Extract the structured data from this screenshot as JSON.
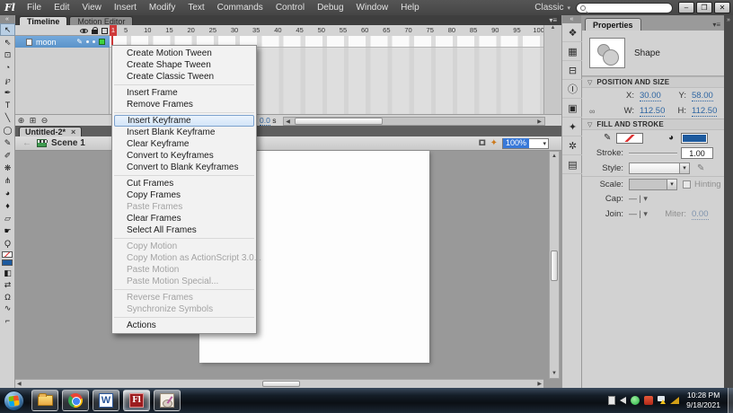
{
  "titlebar": {
    "logo": "Fl",
    "menus": [
      "File",
      "Edit",
      "View",
      "Insert",
      "Modify",
      "Text",
      "Commands",
      "Control",
      "Debug",
      "Window",
      "Help"
    ],
    "workspace": "Classic",
    "window": {
      "minimize": "–",
      "restore": "❐",
      "close": "✕"
    }
  },
  "tools": {
    "collapse": "«",
    "main": [
      {
        "name": "selection-tool",
        "glyph": "↖",
        "active": true
      },
      {
        "name": "subselection-tool",
        "glyph": "⇖"
      },
      {
        "name": "free-transform-tool",
        "glyph": "⊡"
      },
      {
        "name": "3d-rotation-tool",
        "glyph": "◔"
      },
      {
        "name": "lasso-tool",
        "glyph": "℘"
      },
      {
        "name": "pen-tool",
        "glyph": "✒"
      },
      {
        "name": "text-tool",
        "glyph": "T"
      },
      {
        "name": "line-tool",
        "glyph": "╲"
      },
      {
        "name": "oval-tool",
        "glyph": "◯"
      },
      {
        "name": "pencil-tool",
        "glyph": "✎"
      },
      {
        "name": "brush-tool",
        "glyph": "✐"
      },
      {
        "name": "deco-tool",
        "glyph": "❋"
      },
      {
        "name": "bone-tool",
        "glyph": "⋔"
      },
      {
        "name": "paint-bucket-tool",
        "glyph": "◕"
      },
      {
        "name": "eyedropper-tool",
        "glyph": "♦"
      },
      {
        "name": "eraser-tool",
        "glyph": "▱"
      },
      {
        "name": "hand-tool",
        "glyph": "☛"
      },
      {
        "name": "zoom-tool",
        "glyph": "Ϙ"
      }
    ],
    "options": [
      {
        "name": "black-white-swatch-button",
        "glyph": "◧"
      },
      {
        "name": "swap-colors-button",
        "glyph": "⇄"
      },
      {
        "name": "snap-to-objects-button",
        "glyph": "Ω"
      },
      {
        "name": "smooth-button",
        "glyph": "∿"
      },
      {
        "name": "straighten-button",
        "glyph": "⌐"
      }
    ]
  },
  "timeline": {
    "tabs": [
      {
        "name": "tab-timeline",
        "label": "Timeline",
        "active": true
      },
      {
        "name": "tab-motion-editor",
        "label": "Motion Editor"
      }
    ],
    "panel_menu_glyph": "▾≡",
    "current_frame": "1",
    "ruler_numbers": [
      "5",
      "10",
      "15",
      "20",
      "25",
      "30",
      "35",
      "40",
      "45",
      "50",
      "55",
      "60",
      "65",
      "70",
      "75",
      "80",
      "85",
      "90",
      "95",
      "100"
    ],
    "layer": {
      "name": "moon"
    },
    "footer_icons": [
      {
        "name": "new-layer-button",
        "glyph": "⊕"
      },
      {
        "name": "new-folder-button",
        "glyph": "⊞"
      },
      {
        "name": "delete-layer-button",
        "glyph": "⊖"
      }
    ],
    "footer": {
      "elapsed_time_value": "0.0",
      "elapsed_time_unit": "s"
    }
  },
  "context_menu": {
    "items": [
      {
        "label": "Create Motion Tween"
      },
      {
        "label": "Create Shape Tween"
      },
      {
        "label": "Create Classic Tween",
        "separator_after": true
      },
      {
        "label": "Insert Frame"
      },
      {
        "label": "Remove Frames",
        "separator_after": true
      },
      {
        "label": "Insert Keyframe",
        "highlighted": true
      },
      {
        "label": "Insert Blank Keyframe"
      },
      {
        "label": "Clear Keyframe"
      },
      {
        "label": "Convert to Keyframes"
      },
      {
        "label": "Convert to Blank Keyframes",
        "separator_after": true
      },
      {
        "label": "Cut Frames"
      },
      {
        "label": "Copy Frames"
      },
      {
        "label": "Paste Frames",
        "disabled": true
      },
      {
        "label": "Clear Frames"
      },
      {
        "label": "Select All Frames",
        "separator_after": true
      },
      {
        "label": "Copy Motion",
        "disabled": true
      },
      {
        "label": "Copy Motion as ActionScript 3.0...",
        "disabled": true
      },
      {
        "label": "Paste Motion",
        "disabled": true
      },
      {
        "label": "Paste Motion Special...",
        "disabled": true,
        "separator_after": true
      },
      {
        "label": "Reverse Frames",
        "disabled": true
      },
      {
        "label": "Synchronize Symbols",
        "disabled": true,
        "separator_after": true
      },
      {
        "label": "Actions"
      }
    ]
  },
  "document": {
    "tab_label": "Untitled-2*",
    "close_glyph": "×",
    "back_glyph": "←",
    "scene_label": "Scene 1",
    "zoom_value": "100%"
  },
  "properties": {
    "tab": "Properties",
    "panel_menu_glyph": "▾≡",
    "object_type": "Shape",
    "position_section": "POSITION AND SIZE",
    "fill_section": "FILL AND STROKE",
    "x_label": "X:",
    "x_value": "30.00",
    "y_label": "Y:",
    "y_value": "58.00",
    "w_label": "W:",
    "w_value": "112.50",
    "h_label": "H:",
    "h_value": "112.50",
    "stroke_label": "Stroke:",
    "stroke_value": "1.00",
    "style_label": "Style:",
    "scale_label": "Scale:",
    "hinting_label": "Hinting",
    "cap_label": "Cap:",
    "join_label": "Join:",
    "miter_label": "Miter:",
    "miter_value": "0.00",
    "fill_color": "#1d5a9e",
    "hot_text_color": "#2f66a2"
  },
  "dock": {
    "collapse_left": "«",
    "collapse_right": "»",
    "icons": [
      {
        "name": "color-panel-icon",
        "glyph": "❖"
      },
      {
        "name": "swatches-panel-icon",
        "glyph": "▦"
      },
      {
        "name": "align-panel-icon",
        "glyph": "⊟"
      },
      {
        "name": "info-panel-icon",
        "glyph": "Ⓘ"
      },
      {
        "name": "transform-panel-icon",
        "glyph": "▣"
      },
      {
        "name": "motion-presets-panel-icon",
        "glyph": "✦"
      },
      {
        "name": "code-snippets-panel-icon",
        "glyph": "✲"
      },
      {
        "name": "library-panel-icon",
        "glyph": "▤"
      }
    ]
  },
  "taskbar": {
    "app_icons": [
      "start",
      "file-explorer",
      "chrome",
      "word",
      "flash",
      "paint"
    ],
    "tray_icons": [
      "notification-page",
      "speaker",
      "green-app",
      "red-app",
      "action-flag",
      "network-wedge"
    ],
    "time": "10:28 PM",
    "date": "9/18/2021"
  }
}
